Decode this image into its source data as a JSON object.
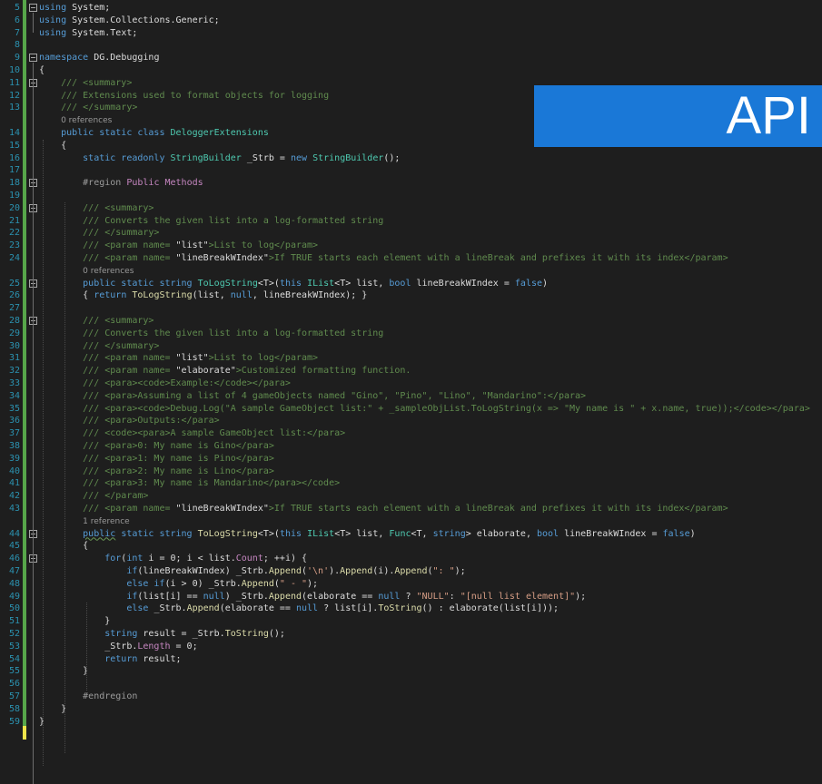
{
  "banner": {
    "text": "API",
    "color": "#1a78d7"
  },
  "editor": {
    "first_line_number": 5,
    "lines": [
      {
        "n": "5",
        "fold": true,
        "t": [
          [
            "kw",
            "using"
          ],
          [
            "",
            "System;"
          ]
        ]
      },
      {
        "n": "6",
        "t": [
          [
            "kw",
            "using"
          ],
          [
            "",
            "System.Collections.Generic;"
          ]
        ]
      },
      {
        "n": "7",
        "t": [
          [
            "kw",
            "using"
          ],
          [
            "",
            "System.Text;"
          ]
        ]
      },
      {
        "n": "8",
        "t": []
      },
      {
        "n": "9",
        "fold": true,
        "t": [
          [
            "kw",
            "namespace"
          ],
          [
            "",
            "DG.Debugging"
          ]
        ]
      },
      {
        "n": "10",
        "t": [
          [
            "",
            "{"
          ]
        ]
      },
      {
        "n": "11",
        "fold": true,
        "indent": 4,
        "t": [
          [
            "dc",
            "/// <summary>"
          ]
        ]
      },
      {
        "n": "12",
        "indent": 4,
        "t": [
          [
            "dc",
            "/// Extensions used to format objects for logging"
          ]
        ]
      },
      {
        "n": "13",
        "indent": 4,
        "t": [
          [
            "dc",
            "/// </summary>"
          ]
        ]
      },
      {
        "lens": "0 references",
        "indent": 4
      },
      {
        "n": "14",
        "indent": 4,
        "t": [
          [
            "kw",
            "public static class"
          ],
          [
            "ty",
            "DeloggerExtensions"
          ]
        ]
      },
      {
        "n": "15",
        "indent": 4,
        "t": [
          [
            "",
            "{"
          ]
        ]
      },
      {
        "n": "16",
        "indent": 8,
        "t": [
          [
            "kw",
            "static readonly"
          ],
          [
            "ty",
            "StringBuilder"
          ],
          [
            "",
            "_Strb ="
          ],
          [
            "kw",
            "new"
          ],
          [
            "ty",
            "StringBuilder"
          ],
          [
            "",
            "();"
          ]
        ]
      },
      {
        "n": "17",
        "t": []
      },
      {
        "n": "18",
        "fold": true,
        "indent": 8,
        "t": [
          [
            "pp",
            "#region"
          ],
          [
            "pu",
            "Public Methods"
          ]
        ]
      },
      {
        "n": "19",
        "t": []
      },
      {
        "n": "20",
        "fold": true,
        "indent": 8,
        "t": [
          [
            "dc",
            "/// <summary>"
          ]
        ]
      },
      {
        "n": "21",
        "indent": 8,
        "t": [
          [
            "dc",
            "/// Converts the given list into a log-formatted string"
          ]
        ]
      },
      {
        "n": "22",
        "indent": 8,
        "t": [
          [
            "dc",
            "/// </summary>"
          ]
        ]
      },
      {
        "n": "23",
        "indent": 8,
        "t": [
          [
            "dc",
            "/// <param name="
          ],
          [
            "",
            "\"list\""
          ],
          [
            "dc",
            ">List to log</param>"
          ]
        ]
      },
      {
        "n": "24",
        "indent": 8,
        "t": [
          [
            "dc",
            "/// <param name="
          ],
          [
            "",
            "\"lineBreakWIndex\""
          ],
          [
            "dc",
            ">If TRUE starts each element with a lineBreak and prefixes it with its index</param>"
          ]
        ]
      },
      {
        "lens": "0 references",
        "indent": 8
      },
      {
        "n": "25",
        "fold": true,
        "indent": 8,
        "t": [
          [
            "kw",
            "public static string"
          ],
          [
            "ty",
            "ToLogString"
          ],
          [
            "",
            "<T>("
          ],
          [
            "kw",
            "this"
          ],
          [
            "ty",
            "IList"
          ],
          [
            "",
            "<T> list,"
          ],
          [
            "kw",
            "bool"
          ],
          [
            "",
            "lineBreakWIndex ="
          ],
          [
            "kw",
            "false"
          ],
          [
            "",
            ")"
          ]
        ]
      },
      {
        "n": "26",
        "indent": 8,
        "t": [
          [
            "",
            "{"
          ],
          [
            "kw",
            "return"
          ],
          [
            "mt",
            "ToLogString"
          ],
          [
            "",
            "(list,"
          ],
          [
            "kw",
            "null"
          ],
          [
            "",
            ", lineBreakWIndex); }"
          ]
        ]
      },
      {
        "n": "27",
        "t": []
      },
      {
        "n": "28",
        "fold": true,
        "indent": 8,
        "t": [
          [
            "dc",
            "/// <summary>"
          ]
        ]
      },
      {
        "n": "29",
        "indent": 8,
        "t": [
          [
            "dc",
            "/// Converts the given list into a log-formatted string"
          ]
        ]
      },
      {
        "n": "30",
        "indent": 8,
        "t": [
          [
            "dc",
            "/// </summary>"
          ]
        ]
      },
      {
        "n": "31",
        "indent": 8,
        "t": [
          [
            "dc",
            "/// <param name="
          ],
          [
            "",
            "\"list\""
          ],
          [
            "dc",
            ">List to log</param>"
          ]
        ]
      },
      {
        "n": "32",
        "indent": 8,
        "t": [
          [
            "dc",
            "/// <param name="
          ],
          [
            "",
            "\"elaborate\""
          ],
          [
            "dc",
            ">Customized formatting function."
          ]
        ]
      },
      {
        "n": "33",
        "indent": 8,
        "t": [
          [
            "dc",
            "/// <para><code>Example:</code></para>"
          ]
        ]
      },
      {
        "n": "34",
        "indent": 8,
        "t": [
          [
            "dc",
            "/// <para>Assuming a list of 4 gameObjects named \"Gino\", \"Pino\", \"Lino\", \"Mandarino\":</para>"
          ]
        ]
      },
      {
        "n": "35",
        "indent": 8,
        "t": [
          [
            "dc",
            "/// <para><code>Debug.Log(\"A sample GameObject list:\" + _sampleObjList.ToLogString(x => \"My name is \" + x.name, true));</code></para>"
          ]
        ]
      },
      {
        "n": "36",
        "indent": 8,
        "t": [
          [
            "dc",
            "/// <para>Outputs:</para>"
          ]
        ]
      },
      {
        "n": "37",
        "indent": 8,
        "t": [
          [
            "dc",
            "/// <code><para>A sample GameObject list:</para>"
          ]
        ]
      },
      {
        "n": "38",
        "indent": 8,
        "t": [
          [
            "dc",
            "/// <para>0: My name is Gino</para>"
          ]
        ]
      },
      {
        "n": "39",
        "indent": 8,
        "t": [
          [
            "dc",
            "/// <para>1: My name is Pino</para>"
          ]
        ]
      },
      {
        "n": "40",
        "indent": 8,
        "t": [
          [
            "dc",
            "/// <para>2: My name is Lino</para>"
          ]
        ]
      },
      {
        "n": "41",
        "indent": 8,
        "t": [
          [
            "dc",
            "/// <para>3: My name is Mandarino</para></code>"
          ]
        ]
      },
      {
        "n": "42",
        "indent": 8,
        "t": [
          [
            "dc",
            "/// </param>"
          ]
        ]
      },
      {
        "n": "43",
        "indent": 8,
        "t": [
          [
            "dc",
            "/// <param name="
          ],
          [
            "",
            "\"lineBreakWIndex\""
          ],
          [
            "dc",
            ">If TRUE starts each element with a lineBreak and prefixes it with its index</param>"
          ]
        ]
      },
      {
        "lens": "1 reference",
        "indent": 8
      },
      {
        "n": "44",
        "fold": true,
        "indent": 8,
        "t": [
          [
            "kw wavy",
            "public"
          ],
          [
            "kw",
            "static string"
          ],
          [
            "mt",
            "ToLogString"
          ],
          [
            "",
            "<T>("
          ],
          [
            "kw",
            "this"
          ],
          [
            "ty",
            "IList"
          ],
          [
            "",
            "<T> list,"
          ],
          [
            "ty",
            "Func"
          ],
          [
            "",
            "<T,"
          ],
          [
            "kw",
            "string"
          ],
          [
            "",
            "> elaborate,"
          ],
          [
            "kw",
            "bool"
          ],
          [
            "",
            "lineBreakWIndex ="
          ],
          [
            "kw",
            "false"
          ],
          [
            "",
            ")"
          ]
        ]
      },
      {
        "n": "45",
        "indent": 8,
        "t": [
          [
            "",
            "{"
          ]
        ]
      },
      {
        "n": "46",
        "fold": true,
        "indent": 12,
        "t": [
          [
            "kw",
            "for"
          ],
          [
            "",
            "("
          ],
          [
            "kw",
            "int"
          ],
          [
            "",
            "i = 0; i < list."
          ],
          [
            "pu",
            "Count"
          ],
          [
            "",
            "; ++i) {"
          ]
        ]
      },
      {
        "n": "47",
        "indent": 16,
        "t": [
          [
            "kw",
            "if"
          ],
          [
            "",
            "(lineBreakWIndex) _Strb."
          ],
          [
            "mt",
            "Append"
          ],
          [
            "",
            "("
          ],
          [
            "st",
            "'\\n'"
          ],
          [
            "",
            ")."
          ],
          [
            "mt",
            "Append"
          ],
          [
            "",
            "(i)."
          ],
          [
            "mt",
            "Append"
          ],
          [
            "",
            "("
          ],
          [
            "st",
            "\": \""
          ],
          [
            "",
            ");"
          ]
        ]
      },
      {
        "n": "48",
        "indent": 16,
        "t": [
          [
            "kw",
            "else if"
          ],
          [
            "",
            "(i > 0) _Strb."
          ],
          [
            "mt",
            "Append"
          ],
          [
            "",
            "("
          ],
          [
            "st",
            "\" - \""
          ],
          [
            "",
            ");"
          ]
        ]
      },
      {
        "n": "49",
        "indent": 16,
        "t": [
          [
            "kw",
            "if"
          ],
          [
            "",
            "(list[i] =="
          ],
          [
            "kw",
            "null"
          ],
          [
            "",
            ") _Strb."
          ],
          [
            "mt",
            "Append"
          ],
          [
            "",
            "(elaborate =="
          ],
          [
            "kw",
            "null"
          ],
          [
            "",
            "?"
          ],
          [
            "st",
            "\"NULL\""
          ],
          [
            "",
            ":"
          ],
          [
            "st",
            "\"[null list element]\""
          ],
          [
            "",
            ");"
          ]
        ]
      },
      {
        "n": "50",
        "indent": 16,
        "t": [
          [
            "kw",
            "else"
          ],
          [
            "",
            "_Strb."
          ],
          [
            "mt",
            "Append"
          ],
          [
            "",
            "(elaborate =="
          ],
          [
            "kw",
            "null"
          ],
          [
            "",
            "? list[i]."
          ],
          [
            "mt",
            "ToString"
          ],
          [
            "",
            "() : elaborate(list[i]));"
          ]
        ]
      },
      {
        "n": "51",
        "indent": 12,
        "t": [
          [
            "",
            "}"
          ]
        ]
      },
      {
        "n": "52",
        "indent": 12,
        "t": [
          [
            "kw",
            "string"
          ],
          [
            "",
            "result = _Strb."
          ],
          [
            "mt",
            "ToString"
          ],
          [
            "",
            "();"
          ]
        ]
      },
      {
        "n": "53",
        "indent": 12,
        "t": [
          [
            "",
            "_Strb."
          ],
          [
            "pu",
            "Length"
          ],
          [
            "",
            "= 0;"
          ]
        ]
      },
      {
        "n": "54",
        "indent": 12,
        "t": [
          [
            "kw",
            "return"
          ],
          [
            "",
            "result;"
          ]
        ]
      },
      {
        "n": "55",
        "indent": 8,
        "t": [
          [
            "",
            "}"
          ]
        ]
      },
      {
        "n": "56",
        "t": []
      },
      {
        "n": "57",
        "indent": 8,
        "t": [
          [
            "pp",
            "#endregion"
          ]
        ]
      },
      {
        "n": "58",
        "indent": 4,
        "t": [
          [
            "",
            "}"
          ]
        ]
      },
      {
        "n": "59",
        "t": [
          [
            "",
            "}"
          ]
        ]
      }
    ]
  }
}
